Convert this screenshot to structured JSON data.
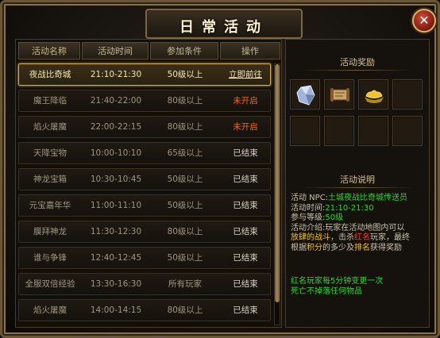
{
  "window": {
    "title": "日常活动",
    "close_label": "✕"
  },
  "table": {
    "headers": [
      "活动名称",
      "活动时间",
      "参加条件",
      "操作"
    ],
    "rows": [
      {
        "name": "夜战比奇城",
        "time": "21:10-21:30",
        "cond": "50级以上",
        "action": "立即前往",
        "state": "go",
        "selected": true
      },
      {
        "name": "魔王降临",
        "time": "21:40-22:00",
        "cond": "80级以上",
        "action": "未开启",
        "state": "no"
      },
      {
        "name": "焰火屠魔",
        "time": "22:00-22:15",
        "cond": "80级以上",
        "action": "未开启",
        "state": "no"
      },
      {
        "name": "天降宝物",
        "time": "10:00-10:10",
        "cond": "65级以上",
        "action": "已结束",
        "state": "end"
      },
      {
        "name": "神龙宝箱",
        "time": "10:30-10:45",
        "cond": "50级以上",
        "action": "已结束",
        "state": "end"
      },
      {
        "name": "元宝嘉年华",
        "time": "11:00-11:10",
        "cond": "50级以上",
        "action": "已结束",
        "state": "end"
      },
      {
        "name": "膜拜神龙",
        "time": "11:30-12:30",
        "cond": "80级以上",
        "action": "已结束",
        "state": "end"
      },
      {
        "name": "谁与争锋",
        "time": "12:40-12:45",
        "cond": "50级以上",
        "action": "已结束",
        "state": "end"
      },
      {
        "name": "全服双倍经验",
        "time": "13:30-16:30",
        "cond": "所有玩家",
        "action": "已结束",
        "state": "end"
      },
      {
        "name": "焰火屠魔",
        "time": "14:00-14:15",
        "cond": "80级以上",
        "action": "已结束",
        "state": "end"
      }
    ]
  },
  "rewards": {
    "title": "活动奖励",
    "items": [
      "crystal-icon",
      "scroll-icon",
      "gold-ingot-icon"
    ]
  },
  "info": {
    "title": "活动说明",
    "npc_label": "活动 NPC:",
    "npc_value": "土城夜战比奇城传送员",
    "time_label": "活动时间:",
    "time_value": "21:10-21:30",
    "level_label": "参与等级:",
    "level_value": "50级",
    "intro_label": "活动介绍:",
    "intro_1": "玩家在活动地图内可以",
    "intro_2a": "放肆的战斗",
    "intro_2b": "，击杀",
    "intro_2c": "红名",
    "intro_2d": "玩家，最终",
    "intro_3a": "根据",
    "intro_3b": "积分",
    "intro_3c": "的多少及",
    "intro_3d": "排名",
    "intro_3e": "获得奖励",
    "notice_1": "红名玩家每5分钟变更一次",
    "notice_2": "死亡不掉落任何物品"
  },
  "colors": {
    "accent": "#d3ad5a",
    "go": "#36d336",
    "not_open": "#e96a1c",
    "highlight": "#f5c22a"
  }
}
